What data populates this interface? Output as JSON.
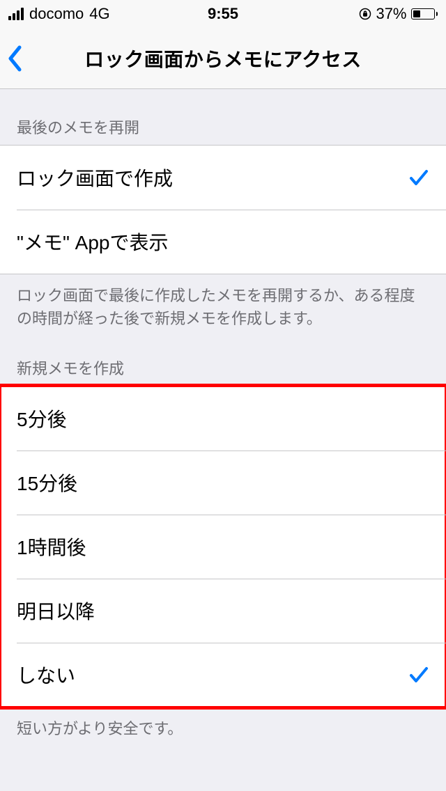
{
  "statusbar": {
    "carrier": "docomo",
    "network": "4G",
    "time": "9:55",
    "battery_pct": "37%"
  },
  "nav": {
    "title": "ロック画面からメモにアクセス"
  },
  "section1": {
    "header": "最後のメモを再開",
    "items": [
      {
        "label": "ロック画面で作成",
        "checked": true
      },
      {
        "label": "\"メモ\" Appで表示",
        "checked": false
      }
    ],
    "footer": "ロック画面で最後に作成したメモを再開するか、ある程度の時間が経った後で新規メモを作成します。"
  },
  "section2": {
    "header": "新規メモを作成",
    "items": [
      {
        "label": "5分後",
        "checked": false
      },
      {
        "label": "15分後",
        "checked": false
      },
      {
        "label": "1時間後",
        "checked": false
      },
      {
        "label": "明日以降",
        "checked": false
      },
      {
        "label": "しない",
        "checked": true
      }
    ],
    "footer": "短い方がより安全です。"
  }
}
